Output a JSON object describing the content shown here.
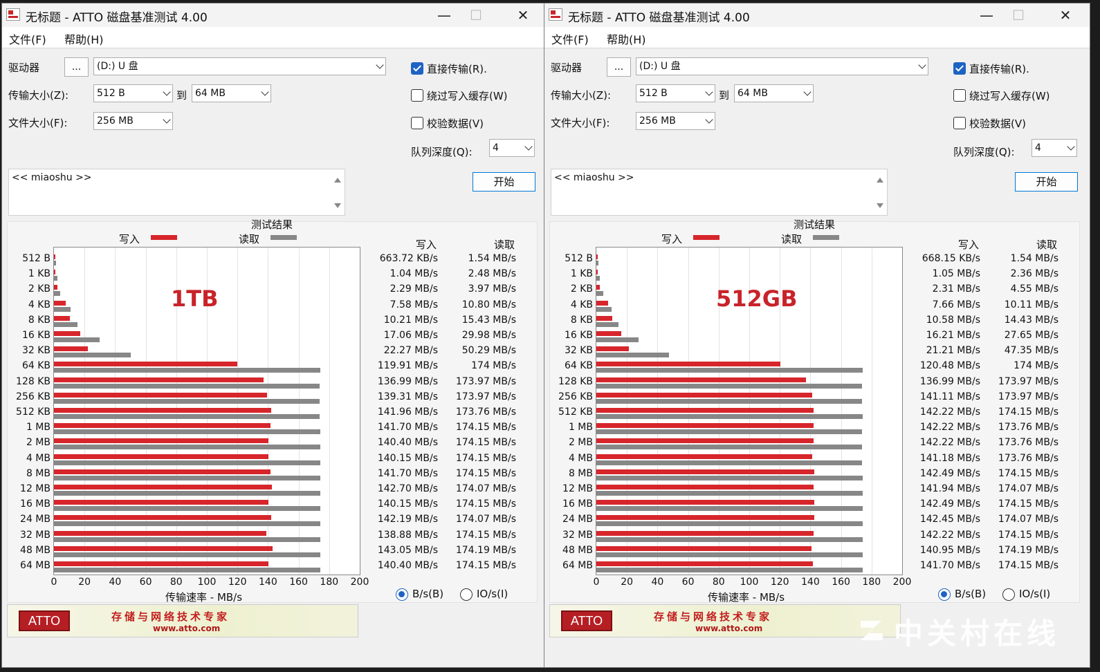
{
  "title": "无标题 - ATTO 磁盘基准测试 4.00",
  "menu": [
    "文件(F)",
    "帮助(H)"
  ],
  "drive_label": "驱动器",
  "browse_label": "...",
  "drive_value": "(D:) U 盘",
  "transfer_label": "传输大小(Z):",
  "transfer_from": "512 B",
  "to_label": "到",
  "transfer_to": "64 MB",
  "filesize_label": "文件大小(F):",
  "filesize_value": "256 MB",
  "direct_io_label": "直接传输(R).",
  "bypass_cache_label": "绕过写入缓存(W)",
  "verify_label": "校验数据(V)",
  "queue_label": "队列深度(Q):",
  "queue_value": "4",
  "description": "<< miaoshu >>",
  "start_label": "开始",
  "results_title": "测试结果",
  "write_label": "写入",
  "read_label": "读取",
  "xaxis_label": "传输速率 - MB/s",
  "unit_bytes_label": "B/s(B)",
  "unit_io_label": "IO/s(I)",
  "atto_logo": "ATTO",
  "atto_slogan": "存储与网络技术专家",
  "atto_url": "www.atto.com",
  "watermark": "中关村在线",
  "colors": {
    "write": "#d7262b",
    "read": "#878787",
    "accent": "#1e63c4"
  },
  "chart_data": [
    {
      "type": "bar",
      "annotation": "1TB",
      "categories": [
        "512 B",
        "1 KB",
        "2 KB",
        "4 KB",
        "8 KB",
        "16 KB",
        "32 KB",
        "64 KB",
        "128 KB",
        "256 KB",
        "512 KB",
        "1 MB",
        "2 MB",
        "4 MB",
        "8 MB",
        "12 MB",
        "16 MB",
        "24 MB",
        "32 MB",
        "48 MB",
        "64 MB"
      ],
      "xlim": [
        0,
        200
      ],
      "xticks": [
        "0",
        "20",
        "40",
        "60",
        "80",
        "100",
        "120",
        "140",
        "160",
        "180",
        "200"
      ],
      "series": [
        {
          "name": "写入",
          "values": [
            0.65,
            1.04,
            2.29,
            7.58,
            10.21,
            17.06,
            22.27,
            119.91,
            136.99,
            139.31,
            141.96,
            141.7,
            140.4,
            140.15,
            141.7,
            142.7,
            140.15,
            142.19,
            138.88,
            143.05,
            140.4
          ],
          "labels": [
            "663.72 KB/s",
            "1.04 MB/s",
            "2.29 MB/s",
            "7.58 MB/s",
            "10.21 MB/s",
            "17.06 MB/s",
            "22.27 MB/s",
            "119.91 MB/s",
            "136.99 MB/s",
            "139.31 MB/s",
            "141.96 MB/s",
            "141.70 MB/s",
            "140.40 MB/s",
            "140.15 MB/s",
            "141.70 MB/s",
            "142.70 MB/s",
            "140.15 MB/s",
            "142.19 MB/s",
            "138.88 MB/s",
            "143.05 MB/s",
            "140.40 MB/s"
          ]
        },
        {
          "name": "读取",
          "values": [
            1.54,
            2.48,
            3.97,
            10.8,
            15.43,
            29.98,
            50.29,
            174,
            173.97,
            173.97,
            173.76,
            174.15,
            174.15,
            174.15,
            174.15,
            174.07,
            174.15,
            174.07,
            174.15,
            174.19,
            174.15
          ],
          "labels": [
            "1.54 MB/s",
            "2.48 MB/s",
            "3.97 MB/s",
            "10.80 MB/s",
            "15.43 MB/s",
            "29.98 MB/s",
            "50.29 MB/s",
            "174 MB/s",
            "173.97 MB/s",
            "173.97 MB/s",
            "173.76 MB/s",
            "174.15 MB/s",
            "174.15 MB/s",
            "174.15 MB/s",
            "174.15 MB/s",
            "174.07 MB/s",
            "174.15 MB/s",
            "174.07 MB/s",
            "174.15 MB/s",
            "174.19 MB/s",
            "174.15 MB/s"
          ]
        }
      ]
    },
    {
      "type": "bar",
      "annotation": "512GB",
      "categories": [
        "512 B",
        "1 KB",
        "2 KB",
        "4 KB",
        "8 KB",
        "16 KB",
        "32 KB",
        "64 KB",
        "128 KB",
        "256 KB",
        "512 KB",
        "1 MB",
        "2 MB",
        "4 MB",
        "8 MB",
        "12 MB",
        "16 MB",
        "24 MB",
        "32 MB",
        "48 MB",
        "64 MB"
      ],
      "xlim": [
        0,
        200
      ],
      "xticks": [
        "0",
        "20",
        "40",
        "60",
        "80",
        "100",
        "120",
        "140",
        "160",
        "180",
        "200"
      ],
      "series": [
        {
          "name": "写入",
          "values": [
            0.65,
            1.05,
            2.31,
            7.66,
            10.58,
            16.21,
            21.21,
            120.48,
            136.99,
            141.11,
            142.22,
            142.22,
            142.22,
            141.18,
            142.49,
            141.94,
            142.49,
            142.45,
            142.22,
            140.95,
            141.7
          ],
          "labels": [
            "668.15 KB/s",
            "1.05 MB/s",
            "2.31 MB/s",
            "7.66 MB/s",
            "10.58 MB/s",
            "16.21 MB/s",
            "21.21 MB/s",
            "120.48 MB/s",
            "136.99 MB/s",
            "141.11 MB/s",
            "142.22 MB/s",
            "142.22 MB/s",
            "142.22 MB/s",
            "141.18 MB/s",
            "142.49 MB/s",
            "141.94 MB/s",
            "142.49 MB/s",
            "142.45 MB/s",
            "142.22 MB/s",
            "140.95 MB/s",
            "141.70 MB/s"
          ]
        },
        {
          "name": "读取",
          "values": [
            1.54,
            2.36,
            4.55,
            10.11,
            14.43,
            27.65,
            47.35,
            174,
            173.97,
            173.97,
            174.15,
            173.76,
            173.76,
            173.76,
            174.15,
            174.07,
            174.15,
            174.07,
            174.15,
            174.19,
            174.15
          ],
          "labels": [
            "1.54 MB/s",
            "2.36 MB/s",
            "4.55 MB/s",
            "10.11 MB/s",
            "14.43 MB/s",
            "27.65 MB/s",
            "47.35 MB/s",
            "174 MB/s",
            "173.97 MB/s",
            "173.97 MB/s",
            "174.15 MB/s",
            "173.76 MB/s",
            "173.76 MB/s",
            "173.76 MB/s",
            "174.15 MB/s",
            "174.07 MB/s",
            "174.15 MB/s",
            "174.07 MB/s",
            "174.15 MB/s",
            "174.19 MB/s",
            "174.15 MB/s"
          ]
        }
      ]
    }
  ]
}
